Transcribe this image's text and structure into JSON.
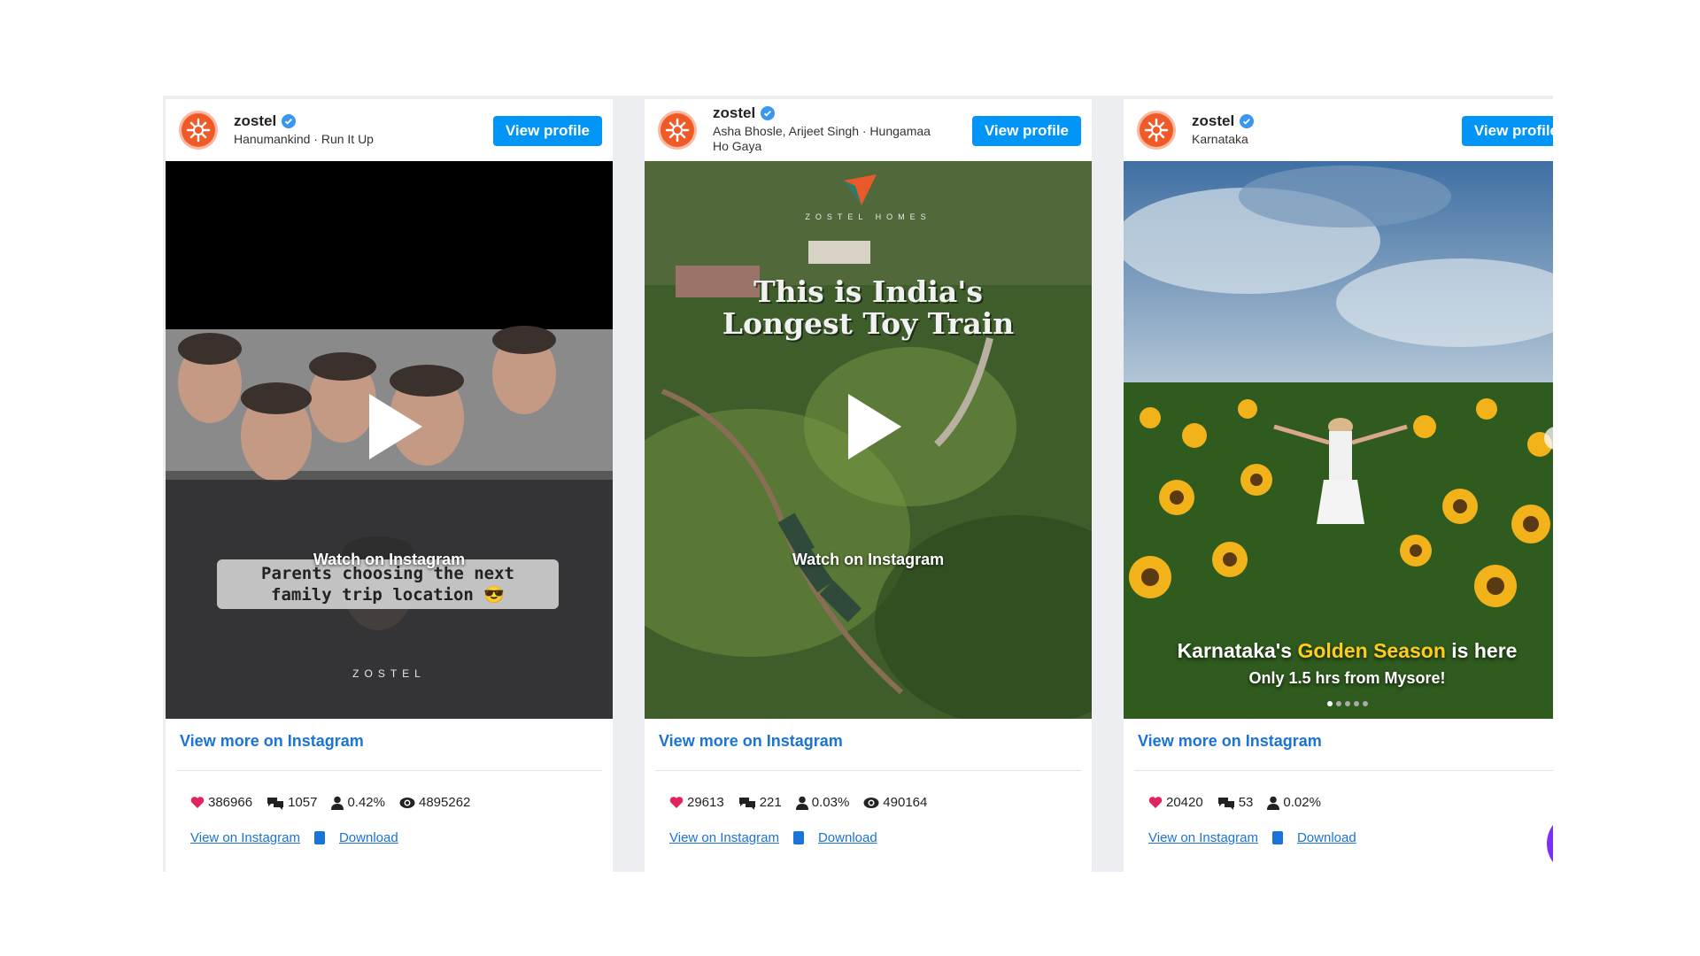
{
  "cards": [
    {
      "account": "zostel",
      "subtitle": "Hanumankind · Run It Up",
      "view_profile": "View profile",
      "watch": "Watch on Instagram",
      "caption_line1": "Parents choosing the next",
      "caption_line2": "family trip location 😎",
      "brand": "ZOSTEL",
      "view_more": "View more on Instagram",
      "likes": "386966",
      "comments": "1057",
      "engagement": "0.42%",
      "views": "4895262",
      "view_on_instagram": "View on Instagram",
      "download": "Download"
    },
    {
      "account": "zostel",
      "subtitle_line1": "Asha Bhosle, Arijeet Singh · Hungamaa",
      "subtitle_line2": "Ho Gaya",
      "view_profile": "View profile",
      "brand": "ZOSTEL HOMES",
      "overlay_line1": "This is India's",
      "overlay_line2": "Longest Toy Train",
      "watch": "Watch on Instagram",
      "view_more": "View more on Instagram",
      "likes": "29613",
      "comments": "221",
      "engagement": "0.03%",
      "views": "490164",
      "view_on_instagram": "View on Instagram",
      "download": "Download"
    },
    {
      "account": "zostel",
      "subtitle": "Karnataka",
      "view_profile": "View profile",
      "title_pre": "Karnataka's ",
      "title_gold": "Golden Season",
      "title_post": " is here",
      "sub": "Only 1.5 hrs from Mysore!",
      "view_more": "View more on Instagram",
      "likes": "20420",
      "comments": "53",
      "engagement": "0.02%",
      "view_on_instagram": "View on Instagram",
      "download": "Download"
    }
  ],
  "colors": {
    "accent": "#0095f6",
    "link": "#1a73d9",
    "heart": "#e0245e",
    "brand_orange": "#f05a28"
  },
  "icons": [
    "zostel-logo-icon",
    "verified-icon",
    "play-icon",
    "heart-icon",
    "comments-icon",
    "user-icon",
    "eye-icon",
    "clipboard-icon",
    "chevron-right-icon"
  ]
}
